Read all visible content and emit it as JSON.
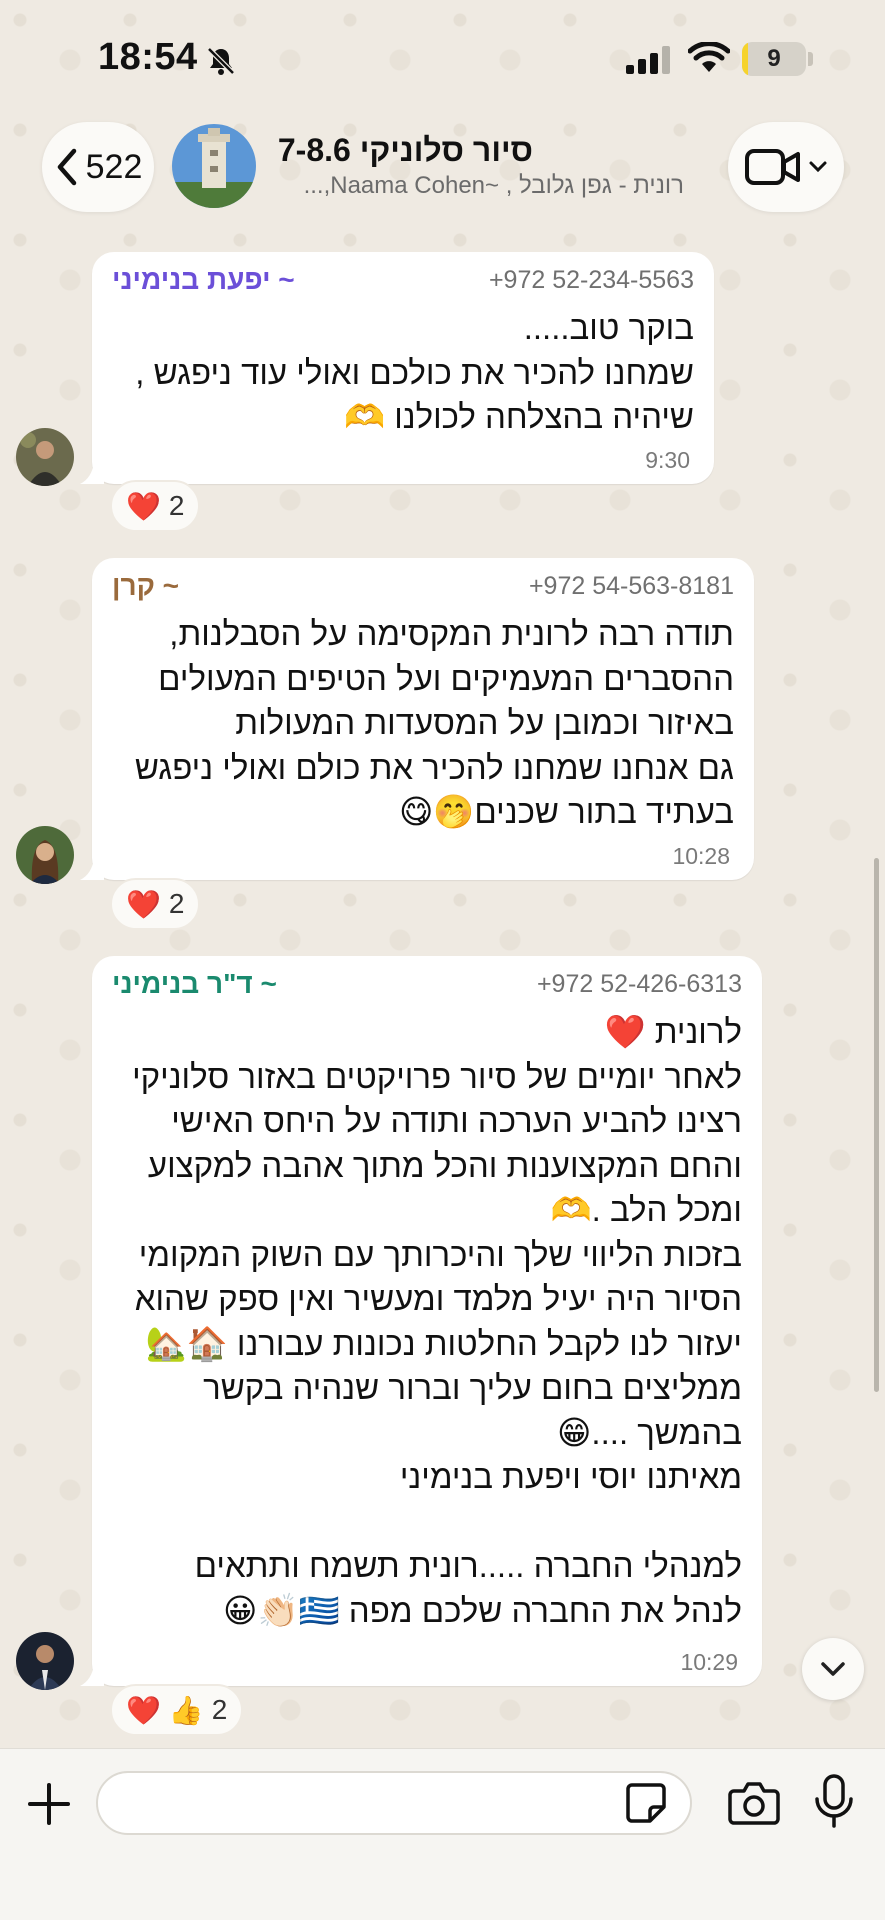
{
  "status_bar": {
    "time": "18:54",
    "battery_level": "9",
    "battery_fraction": 0.09,
    "icons": [
      "bell-off-icon",
      "signal-icon",
      "wifi-icon",
      "battery-icon"
    ]
  },
  "header": {
    "back_count": "522",
    "group_title": "סיור סלוניקי 7-8.6",
    "group_members": "רונית - גפן גלובל ,  ~Naama Cohen,...",
    "icons": [
      "chevron-left-icon",
      "video-camera-icon",
      "chevron-down-icon"
    ]
  },
  "messages": [
    {
      "sender": "~ יפעת בנימיני",
      "sender_color": "#6b4fd8",
      "phone": "+972 52-234-5563",
      "text": "בוקר טוב.....\nשמחנו להכיר את כולכם ואולי עוד ניפגש ,\nשיהיה בהצלחה לכולנו 🫶",
      "time": "9:30",
      "reactions": [
        {
          "emoji": "❤️"
        }
      ],
      "reaction_count": "2"
    },
    {
      "sender": "~ קרן",
      "sender_color": "#9a6a3c",
      "phone": "+972 54-563-8181",
      "text": "תודה רבה לרונית המקסימה על הסבלנות,\nההסברים המעמיקים ועל הטיפים המעולים\nבאיזור וכמובן על המסעדות המעולות\nגם אנחנו שמחנו להכיר את כולם ואולי ניפגש\nבעתיד בתור שכנים🤭😋",
      "time": "10:28",
      "reactions": [
        {
          "emoji": "❤️"
        }
      ],
      "reaction_count": "2"
    },
    {
      "sender": "~ ד\"ר בנימיני",
      "sender_color": "#1a8a6e",
      "phone": "+972 52-426-6313",
      "text": "לרונית ❤️\nלאחר יומיים של סיור פרויקטים באזור סלוניקי\nרצינו להביע הערכה ותודה על היחס האישי\nוהחם המקצוענות והכל מתוך אהבה למקצוע\nומכל הלב .🫶\nבזכות הליווי שלך והיכרותך עם השוק המקומי\nהסיור היה יעיל מלמד ומעשיר ואין ספק שהוא\nיעזור לנו לקבל החלטות נכונות עבורנו 🏠🏡\nממליצים בחום עליך וברור שנהיה בקשר\nבהמשך ....😁\nמאיתנו יוסי ויפעת בנימיני\n\nלמנהלי החברה .....רונית תשמח ותתאים\nלנהל את החברה שלכם מפה 🇬🇷👏🏻😀",
      "time": "10:29",
      "reactions": [
        {
          "emoji": "❤️"
        },
        {
          "emoji": "👍"
        }
      ],
      "reaction_count": "2"
    }
  ],
  "input_bar": {
    "placeholder": "",
    "icons": [
      "plus-icon",
      "sticker-icon",
      "camera-icon",
      "microphone-icon"
    ]
  },
  "colors": {
    "background": "#efeae2",
    "bubble": "#ffffff",
    "reaction_heart": "#e0242a"
  }
}
